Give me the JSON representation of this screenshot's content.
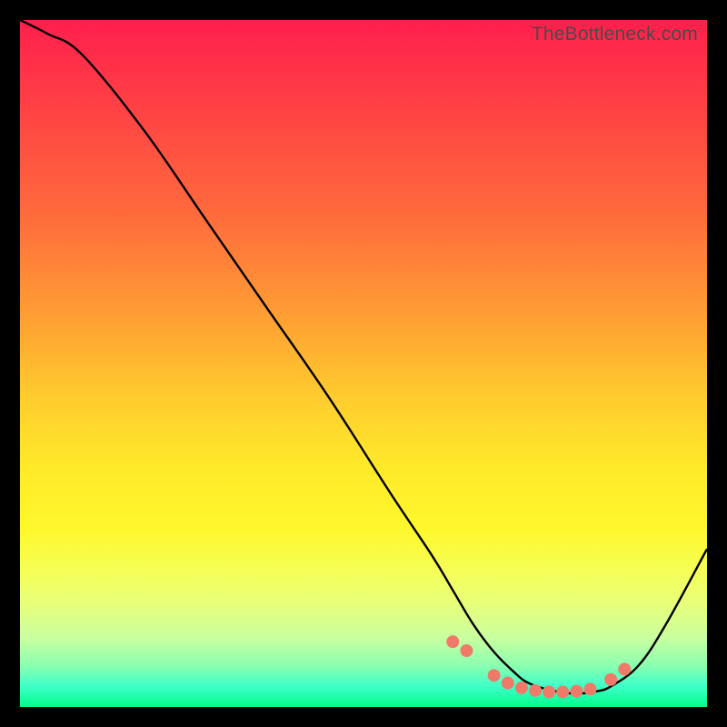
{
  "watermark": "TheBottleneck.com",
  "colors": {
    "background": "#000000",
    "gradient_top": "#ff1f4d",
    "gradient_bottom": "#00ff8a",
    "curve": "#000000",
    "dots": "#f07a6a"
  },
  "chart_data": {
    "type": "line",
    "title": "",
    "xlabel": "",
    "ylabel": "",
    "xlim": [
      0,
      100
    ],
    "ylim": [
      0,
      100
    ],
    "note": "Axes are unlabeled; values estimated from pixel positions on a 0–100 normalized scale. y=0 at bottom (green), y=100 at top (red).",
    "series": [
      {
        "name": "curve",
        "x": [
          0,
          4,
          9,
          18,
          27,
          36,
          45,
          54,
          60,
          63,
          66,
          69,
          72,
          74,
          77,
          80,
          82,
          84,
          86,
          90,
          94,
          100
        ],
        "y": [
          100,
          98,
          95,
          84,
          71,
          58,
          45,
          31,
          22,
          17,
          12,
          8,
          5,
          3.5,
          2.5,
          2,
          2,
          2.3,
          3,
          6,
          12,
          23
        ]
      }
    ],
    "markers": {
      "name": "highlighted-points",
      "x": [
        63,
        65,
        69,
        71,
        73,
        75,
        77,
        79,
        81,
        83,
        86,
        88
      ],
      "y": [
        9.5,
        8.2,
        4.6,
        3.5,
        2.8,
        2.4,
        2.2,
        2.2,
        2.3,
        2.6,
        4.0,
        5.5
      ]
    }
  }
}
